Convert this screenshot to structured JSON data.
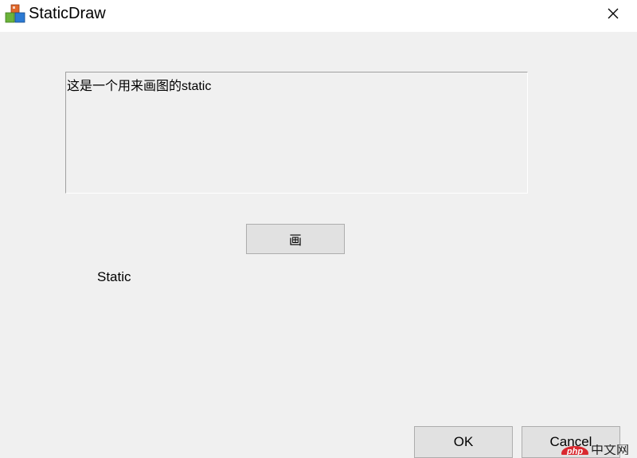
{
  "window": {
    "title": "StaticDraw",
    "app_icon": "app-cube-icon",
    "close_icon": "close-icon"
  },
  "dialog": {
    "static_box_text": "这是一个用来画图的static",
    "draw_button_label": "画",
    "static_label": "Static",
    "ok_label": "OK",
    "cancel_label": "Cancel"
  },
  "watermark": {
    "logo": "php",
    "text": "中文网"
  },
  "colors": {
    "dialog_bg": "#f0f0f0",
    "titlebar_bg": "#ffffff",
    "button_bg": "#e1e1e1",
    "button_border": "#adadad",
    "watermark_red": "#d9282f"
  }
}
